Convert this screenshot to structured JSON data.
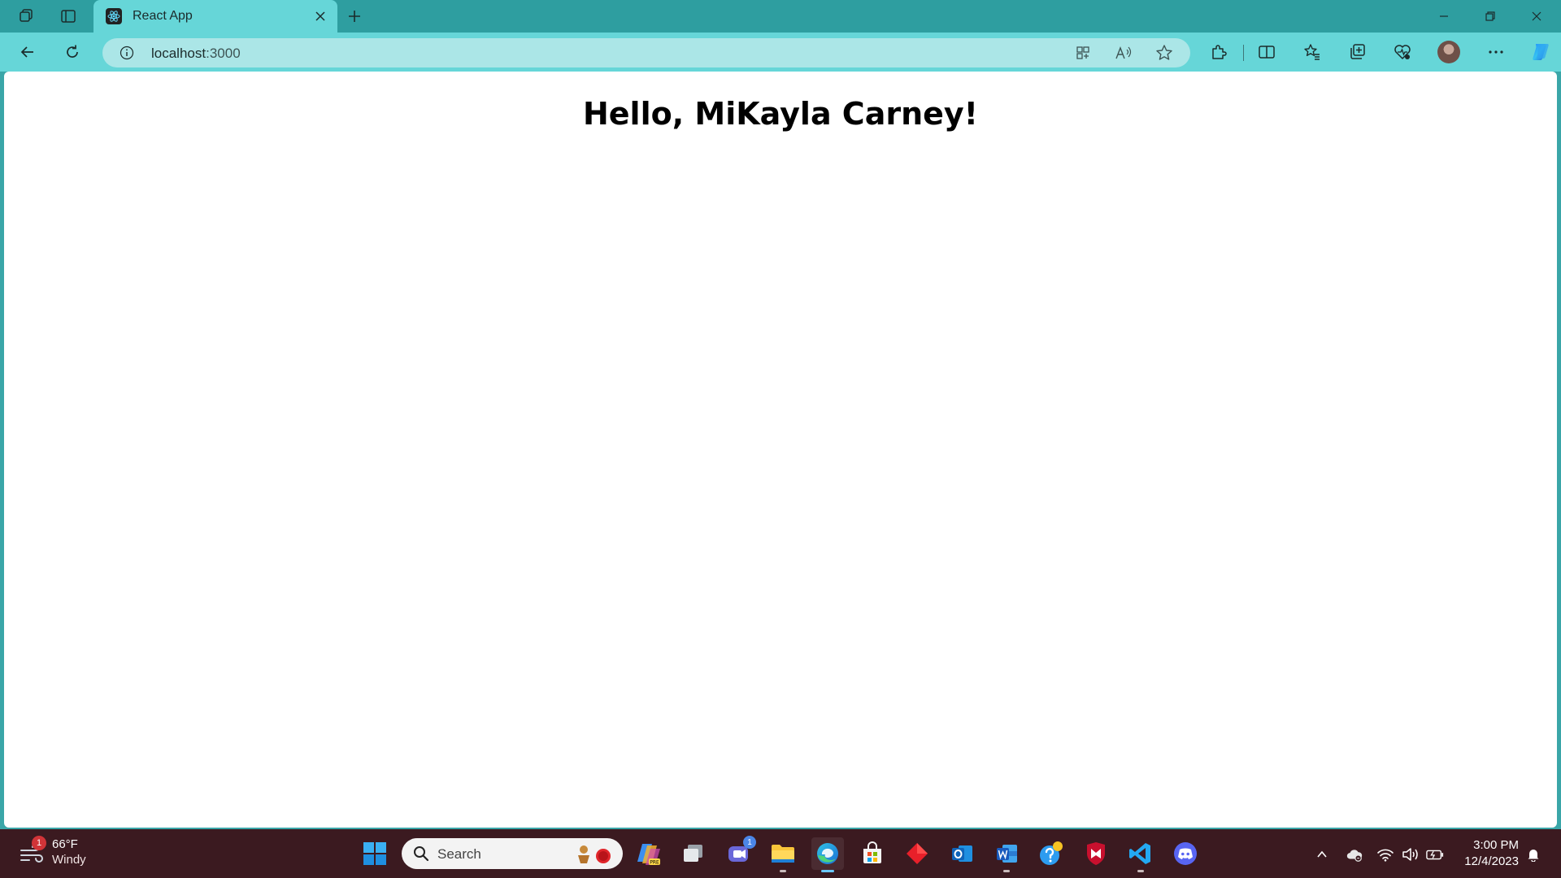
{
  "browser": {
    "tab": {
      "title": "React App",
      "favicon": "react-icon"
    },
    "address": {
      "host": "localhost",
      "port": ":3000"
    },
    "colors": {
      "frame": "#2e9ea0",
      "toolbar": "#66d6d8",
      "omnibox": "#abe6e7"
    }
  },
  "page": {
    "heading": "Hello, MiKayla Carney!"
  },
  "taskbar": {
    "weather": {
      "temp": "66°F",
      "desc": "Windy",
      "badge": "1"
    },
    "search": {
      "placeholder": "Search"
    },
    "teams_badge": "1",
    "clock": {
      "time": "3:00 PM",
      "date": "12/4/2023"
    },
    "colors": {
      "background": "#3b1a20"
    }
  }
}
